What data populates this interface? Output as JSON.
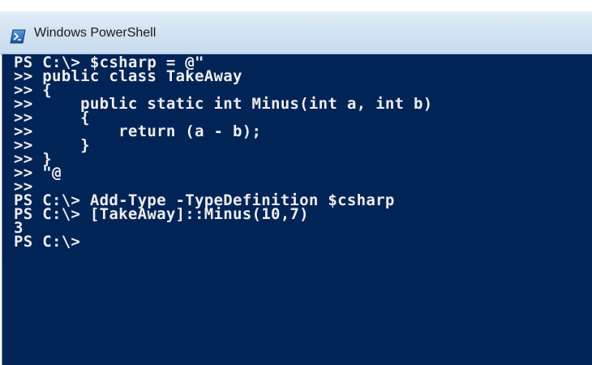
{
  "window": {
    "title": "Windows PowerShell",
    "icon": "powershell-icon",
    "colors": {
      "console_background": "#012456",
      "console_text": "#eeedf0",
      "titlebar": "#d2e2f3"
    }
  },
  "console": {
    "lines": [
      "PS C:\\> $csharp = @\"",
      ">> public class TakeAway",
      ">> {",
      ">>     public static int Minus(int a, int b)",
      ">>     {",
      ">>         return (a - b);",
      ">>     }",
      ">> }",
      ">> \"@",
      ">>",
      "PS C:\\> Add-Type -TypeDefinition $csharp",
      "PS C:\\> [TakeAway]::Minus(10,7)",
      "3",
      "PS C:\\>"
    ]
  }
}
